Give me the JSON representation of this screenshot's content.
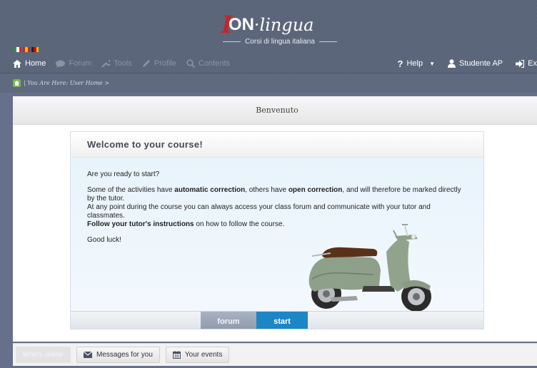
{
  "header": {
    "logo_mark": "I",
    "logo_on": "ON",
    "logo_lingua": "·lingua",
    "logo_subtitle": "Corsi di lingua italiana",
    "flags": [
      "it",
      "es",
      "de"
    ]
  },
  "nav": {
    "left": [
      {
        "label": "Home",
        "icon": "home-icon",
        "active": true
      },
      {
        "label": "Forum",
        "icon": "speech-bubble-icon",
        "active": false
      },
      {
        "label": "Tools",
        "icon": "wrench-icon",
        "active": false
      },
      {
        "label": "Profile",
        "icon": "pencil-icon",
        "active": false
      },
      {
        "label": "Contents",
        "icon": "search-icon",
        "active": false
      }
    ],
    "right": [
      {
        "label": "Help",
        "icon": "question-icon"
      },
      {
        "label": "Studente AP",
        "icon": "user-icon"
      },
      {
        "label": "Ex",
        "icon": "exit-icon"
      }
    ]
  },
  "breadcrumb": {
    "text": "| You Are Here: User Home >"
  },
  "main": {
    "title": "Benvenuto",
    "card": {
      "heading": "Welcome to your course!",
      "line1": "Are you ready to start?",
      "p2_a": "Some of the activities have ",
      "p2_b": "automatic correction",
      "p2_c": ", others have ",
      "p2_d": "open correction",
      "p2_e": ", and will therefore be marked directly by the tutor.",
      "p3": "At any point during the course you can always access your class forum and communicate with your tutor and classmates.",
      "p4_a": "Follow your tutor's instructions",
      "p4_b": " on how to follow the course.",
      "p5": "Good luck!",
      "btn_forum": "forum",
      "btn_start": "start"
    }
  },
  "bottom": {
    "whos_online": "Who's online",
    "messages": "Messages for you",
    "events": "Your events"
  },
  "colors": {
    "brand_red": "#c0272d",
    "start_blue": "#1d86c5",
    "header_bg": "#5a6479"
  }
}
